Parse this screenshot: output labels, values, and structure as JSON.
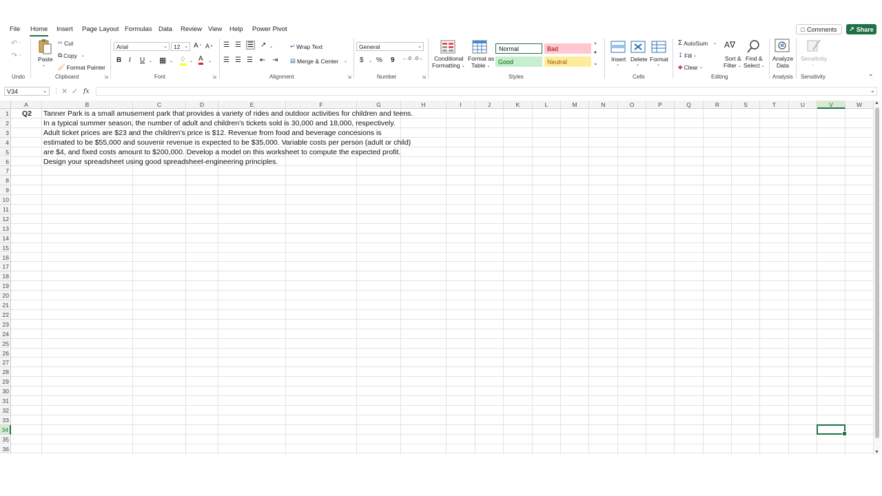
{
  "menu": {
    "tabs": [
      "File",
      "Home",
      "Insert",
      "Page Layout",
      "Formulas",
      "Data",
      "Review",
      "View",
      "Help",
      "Power Pivot"
    ],
    "active_tab": "Home",
    "comments_label": "Comments",
    "share_label": "Share"
  },
  "ribbon": {
    "undo_group": "Undo",
    "clipboard": {
      "paste": "Paste",
      "cut": "Cut",
      "copy": "Copy",
      "format_painter": "Format Painter",
      "label": "Clipboard"
    },
    "font": {
      "name": "Arial",
      "size": "12",
      "label": "Font",
      "bold": "B",
      "italic": "I",
      "underline": "U"
    },
    "alignment": {
      "wrap_text": "Wrap Text",
      "merge_center": "Merge & Center",
      "label": "Alignment"
    },
    "number": {
      "format": "General",
      "label": "Number",
      "currency": "$",
      "percent": "%",
      "comma": "9"
    },
    "styles": {
      "conditional_formatting_1": "Conditional",
      "conditional_formatting_2": "Formatting",
      "format_as_table_1": "Format as",
      "format_as_table_2": "Table",
      "normal": "Normal",
      "bad": "Bad",
      "good": "Good",
      "neutral": "Neutral",
      "label": "Styles"
    },
    "cells": {
      "insert": "Insert",
      "delete": "Delete",
      "format": "Format",
      "label": "Cells"
    },
    "editing": {
      "autosum": "AutoSum",
      "fill": "Fill",
      "clear": "Clear",
      "sort_filter_1": "Sort &",
      "sort_filter_2": "Filter",
      "find_select_1": "Find &",
      "find_select_2": "Select",
      "label": "Editing"
    },
    "analysis": {
      "analyze_1": "Analyze",
      "analyze_2": "Data",
      "label": "Analysis"
    },
    "sensitivity": {
      "button": "Sensitivity",
      "label": "Sensitivity"
    }
  },
  "formula_bar": {
    "name_box": "V34",
    "fx": "fx",
    "formula": ""
  },
  "columns": [
    "A",
    "B",
    "C",
    "D",
    "E",
    "F",
    "G",
    "H",
    "I",
    "J",
    "K",
    "L",
    "M",
    "N",
    "O",
    "P",
    "Q",
    "R",
    "S",
    "T",
    "U",
    "V",
    "W"
  ],
  "rows": [
    "1",
    "2",
    "3",
    "4",
    "5",
    "6",
    "7",
    "8",
    "9",
    "10",
    "11",
    "12",
    "13",
    "14",
    "15",
    "16",
    "17",
    "18",
    "19",
    "20",
    "21",
    "22",
    "23",
    "24",
    "25",
    "26",
    "27",
    "28",
    "29",
    "30",
    "31",
    "32",
    "33",
    "34",
    "35",
    "36"
  ],
  "selected": {
    "column": "V",
    "row": "34"
  },
  "cells": {
    "a1": "Q2",
    "lines": [
      "Tanner Park is a small amusement park that provides a variety of rides and outdoor activities for children and teens.",
      "In a typical summer season, the number of adult and children's tickets sold is 30,000 and 18,000, respectively.",
      "Adult ticket prices are $23 and the children's price is $12. Revenue from food and beverage concesions is",
      "estimated to be $55,000 and souvenir revenue is expected to be $35,000. Variable costs per person (adult or child)",
      "are $4, and fixed costs amount to $200,000. Develop a model on this worksheet to compute the expected profit.",
      "Design your spreadsheet using good spreadsheet-engineering principles."
    ]
  },
  "colors": {
    "accent": "#1e7145",
    "bad_bg": "#ffc7ce",
    "bad_fg": "#9c0006",
    "good_bg": "#c6efce",
    "good_fg": "#006100",
    "neutral_bg": "#ffeb9c",
    "neutral_fg": "#9c5700"
  }
}
